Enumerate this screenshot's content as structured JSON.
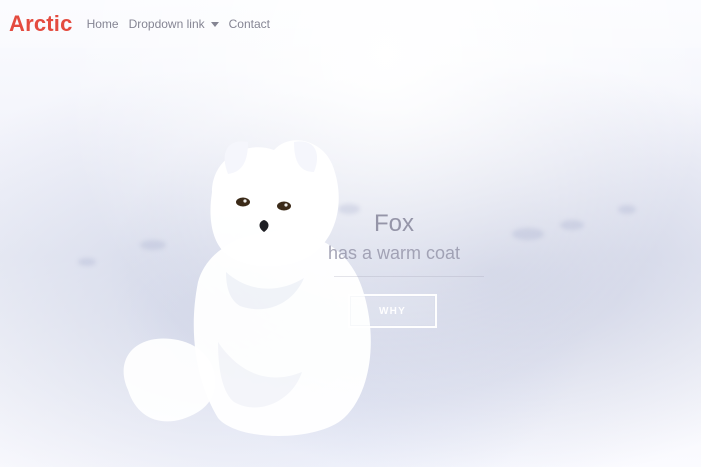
{
  "navbar": {
    "brand": "Arctic",
    "links": [
      {
        "label": "Home"
      },
      {
        "label": "Dropdown link"
      },
      {
        "label": "Contact"
      }
    ]
  },
  "hero": {
    "title": "Fox",
    "subtitle": "has a warm coat",
    "cta_label": "WHY"
  },
  "colors": {
    "brand": "#e44b3f",
    "nav_text": "#78788a",
    "hero_text": "#8c8ca0",
    "cta_border": "#ffffff"
  },
  "icons": {
    "dropdown_caret": "chevron-down-icon"
  }
}
